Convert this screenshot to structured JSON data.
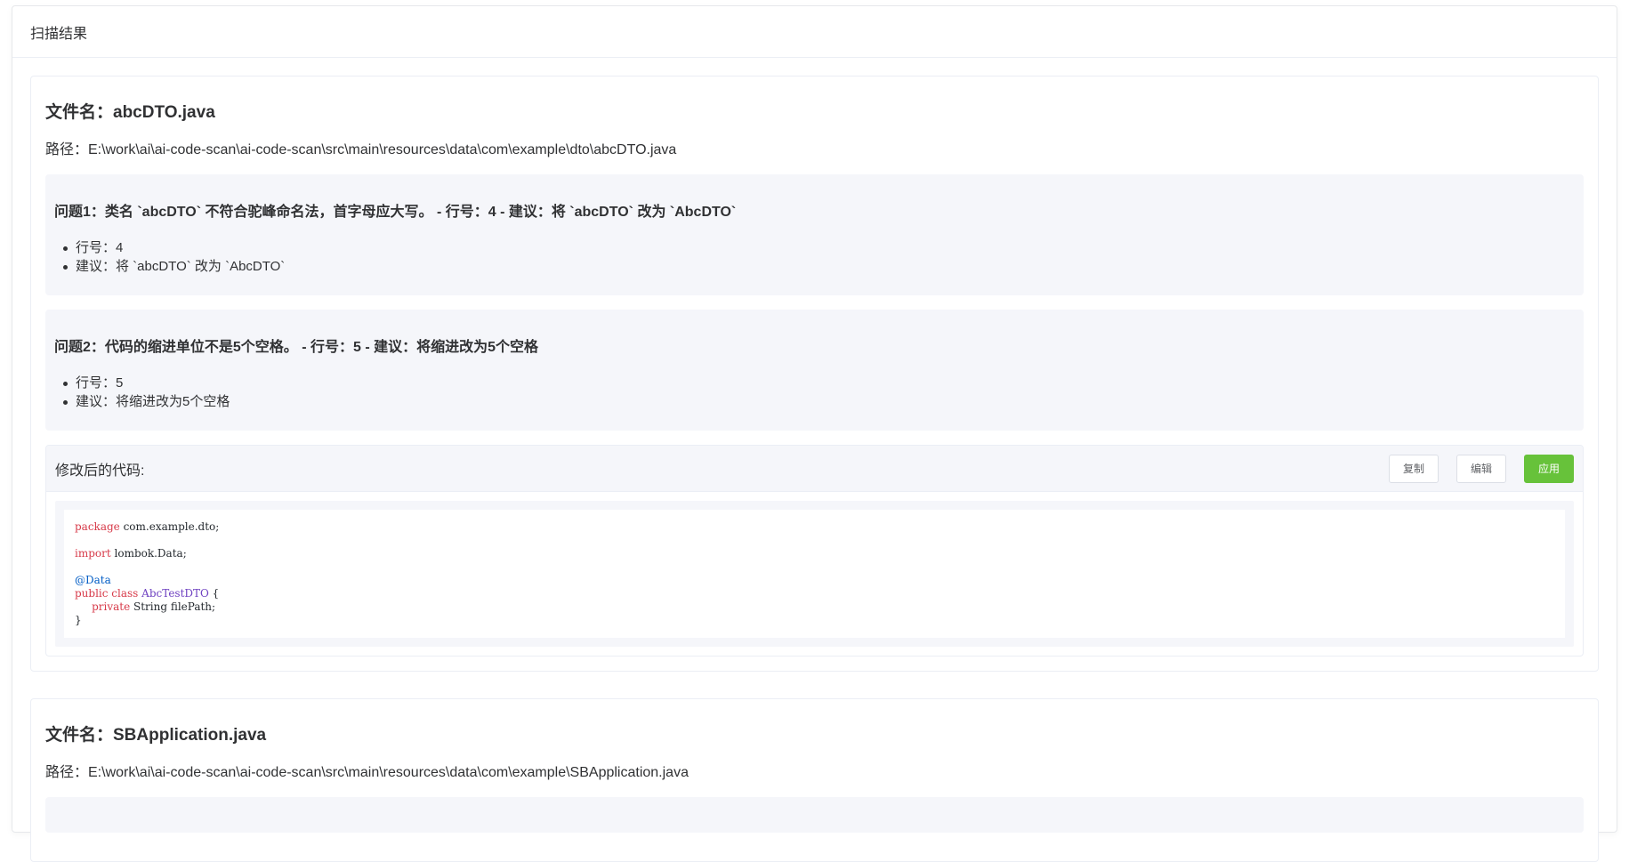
{
  "panel": {
    "title": "扫描结果"
  },
  "files": [
    {
      "title": "文件名：abcDTO.java",
      "path": "路径：E:\\work\\ai\\ai-code-scan\\ai-code-scan\\src\\main\\resources\\data\\com\\example\\dto\\abcDTO.java",
      "issues": [
        {
          "title": "问题1：类名 `abcDTO` 不符合驼峰命名法，首字母应大写。 - 行号：4 - 建议：将 `abcDTO` 改为 `AbcDTO`",
          "items": [
            "行号：4",
            "建议：将 `abcDTO` 改为 `AbcDTO`"
          ]
        },
        {
          "title": "问题2：代码的缩进单位不是5个空格。 - 行号：5 - 建议：将缩进改为5个空格",
          "items": [
            "行号：5",
            "建议：将缩进改为5个空格"
          ]
        }
      ],
      "code_section": {
        "label": "修改后的代码:",
        "copy_label": "复制",
        "edit_label": "编辑",
        "apply_label": "应用",
        "code": {
          "kw_package": "package",
          "package_name": " com.example.dto;",
          "kw_import": "import",
          "import_name": " lombok.Data;",
          "annotation": "@Data",
          "kw_public_class": "public class",
          "class_name": "AbcTestDTO",
          "class_open": " {",
          "indent_kw": "     private",
          "field_decl": " String filePath;",
          "class_close": "}"
        }
      }
    },
    {
      "title": "文件名：SBApplication.java",
      "path": "路径：E:\\work\\ai\\ai-code-scan\\ai-code-scan\\src\\main\\resources\\data\\com\\example\\SBApplication.java"
    }
  ],
  "colors": {
    "apply_button": "#67c23a",
    "keyword": "#d73a49",
    "annotation": "#005cc5",
    "class_name": "#6f42c1",
    "issue_bg": "#f5f6fa"
  }
}
